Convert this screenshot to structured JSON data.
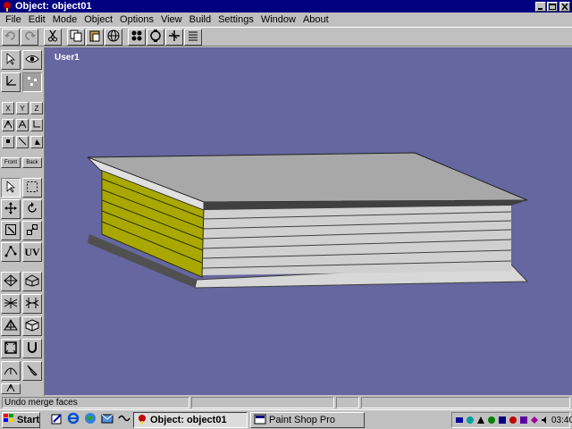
{
  "window": {
    "title": "Object: object01"
  },
  "menu": [
    "File",
    "Edit",
    "Mode",
    "Object",
    "Options",
    "View",
    "Build",
    "Settings",
    "Window",
    "About"
  ],
  "toolbox": {
    "axis_x": "X",
    "axis_y": "Y",
    "axis_z": "Z",
    "front_label": "Front",
    "back_label": "Back",
    "uv_label": "UV"
  },
  "viewport": {
    "label": "User1"
  },
  "status": {
    "text": "Undo merge faces"
  },
  "taskbar": {
    "start_label": "Start",
    "tasks": [
      "Object: object01",
      "Paint Shop Pro"
    ],
    "clock": "03:40"
  },
  "colors": {
    "viewport_bg": "#6666a0",
    "spine": "#a8a800",
    "top_face": "#a8a8a8",
    "pages": "#d0d0d0",
    "cover_edge": "#505050",
    "titlebar": "#000080"
  }
}
